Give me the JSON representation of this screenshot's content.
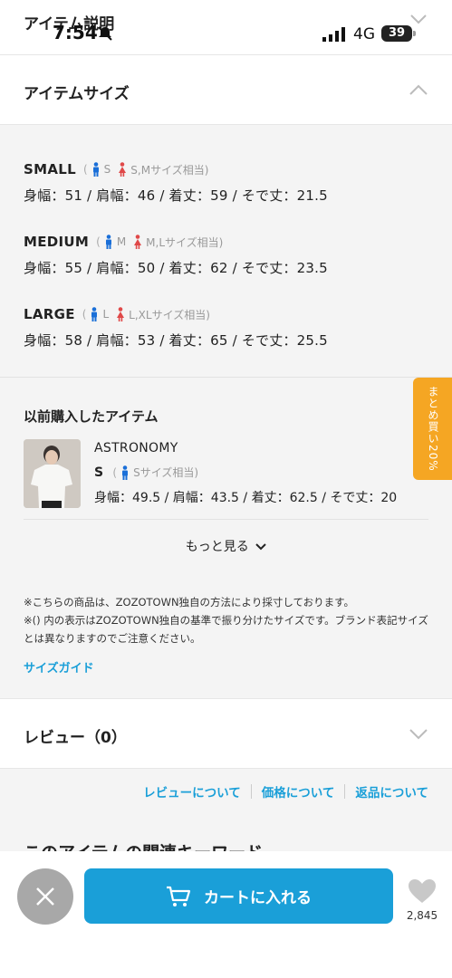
{
  "status_bar": {
    "time": "7:54",
    "network": "4G",
    "battery": "39"
  },
  "top_section": {
    "title_peek": "アイテム説明"
  },
  "item_size": {
    "title": "アイテムサイズ",
    "sizes": [
      {
        "name": "SMALL",
        "paren_open": "(",
        "male": "S",
        "female": "S,Mサイズ相当)",
        "measure": "身幅：51 / 肩幅：46 / 着丈：59 / そで丈：21.5"
      },
      {
        "name": "MEDIUM",
        "paren_open": "(",
        "male": "M",
        "female": "M,Lサイズ相当)",
        "measure": "身幅：55 / 肩幅：50 / 着丈：62 / そで丈：23.5"
      },
      {
        "name": "LARGE",
        "paren_open": "(",
        "male": "L",
        "female": "L,XLサイズ相当)",
        "measure": "身幅：58 / 肩幅：53 / 着丈：65 / そで丈：25.5"
      }
    ]
  },
  "previous_items": {
    "title": "以前購入したアイテム",
    "brand": "ASTRONOMY",
    "size": "S",
    "paren_open": "(",
    "size_note": "Sサイズ相当)",
    "measure": "身幅：49.5 / 肩幅：43.5 / 着丈：62.5 / そで丈：20",
    "more_label": "もっと見る"
  },
  "notes": [
    "※こちらの商品は、ZOZOTOWN独自の方法により採寸しております。",
    "※() 内の表示はZOZOTOWN独自の基準で振り分けたサイズです。ブランド表記サイズとは異なりますのでご注意ください。"
  ],
  "size_guide": "サイズガイド",
  "bulk_tab": "まとめ買い20%",
  "review": {
    "title": "レビュー（0）"
  },
  "links": [
    "レビューについて",
    "価格について",
    "返品について"
  ],
  "next_heading_peek": "このアイテムの関連キーワード",
  "bottom": {
    "cart_label": "カートに入れる",
    "fav_count": "2,845"
  },
  "colors": {
    "accent": "#1a9fd8",
    "bulk": "#f5a623",
    "male": "#1a6fd8",
    "female": "#e04848"
  }
}
